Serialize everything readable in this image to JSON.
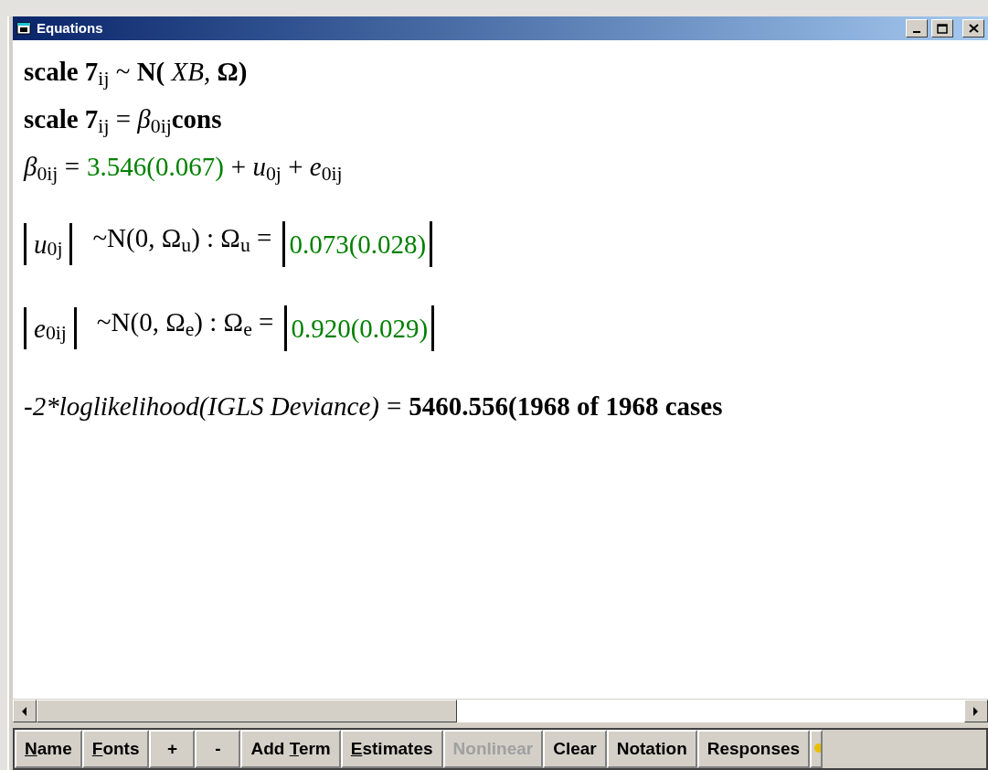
{
  "window": {
    "title": "Equations"
  },
  "equations": [
    {
      "kind": "line",
      "segments": [
        {
          "kind": "term",
          "text": "**scale 7**$_{ij}$ ~ **N(** *XB,*  **Ω)**"
        }
      ]
    },
    {
      "kind": "line",
      "segments": [
        {
          "kind": "term",
          "text": "**scale 7**$_{ij}$ = *β*$_{0ij}$**cons**"
        }
      ]
    },
    {
      "kind": "line",
      "segments": [
        {
          "kind": "term",
          "text": "*β*$_{0ij}$ ="
        },
        {
          "kind": "estimate",
          "text": "3.546(0.067)"
        },
        {
          "kind": "term",
          "text": "+ *u*$_{0j}$ + *e*$_{0ij}$"
        }
      ]
    },
    {
      "kind": "matrix",
      "vector": "*u*$_{0j}$",
      "distribution": "~N(0,  Ω$_{u}$)  :  Ω$_{u}$ =",
      "value": "0.073(0.028)"
    },
    {
      "kind": "matrix",
      "vector": "*e*$_{0ij}$",
      "distribution": "~N(0,  Ω$_{e}$)  :  Ω$_{e}$ =",
      "value": "0.920(0.029)"
    },
    {
      "kind": "line",
      "segments": [
        {
          "kind": "italic",
          "text": "-2*loglikelihood(IGLS Deviance)"
        },
        {
          "kind": "plain",
          "text": "="
        },
        {
          "kind": "bold",
          "text": "5460.556(1968 of 1968 cases"
        }
      ]
    }
  ],
  "toolbar": [
    {
      "parts": [
        {
          "text": "N",
          "underlined": true
        },
        {
          "text": "ame",
          "underlined": false
        }
      ],
      "disabled": false
    },
    {
      "parts": [
        {
          "text": "F",
          "underlined": true
        },
        {
          "text": "onts",
          "underlined": false
        }
      ],
      "disabled": false
    },
    {
      "parts": [
        {
          "text": "+",
          "underlined": false
        }
      ],
      "disabled": false
    },
    {
      "parts": [
        {
          "text": "-",
          "underlined": false
        }
      ],
      "disabled": false
    },
    {
      "parts": [
        {
          "text": "Add ",
          "underlined": false
        },
        {
          "text": "T",
          "underlined": true
        },
        {
          "text": "erm",
          "underlined": false
        }
      ],
      "disabled": false
    },
    {
      "parts": [
        {
          "text": "E",
          "underlined": true
        },
        {
          "text": "stimates",
          "underlined": false
        }
      ],
      "disabled": false
    },
    {
      "parts": [
        {
          "text": "Nonlinear",
          "underlined": false
        }
      ],
      "disabled": true
    },
    {
      "parts": [
        {
          "text": "Clear",
          "underlined": false
        }
      ],
      "disabled": false
    },
    {
      "parts": [
        {
          "text": "Notation",
          "underlined": false
        }
      ],
      "disabled": false
    },
    {
      "parts": [
        {
          "text": "Responses",
          "underlined": false
        }
      ],
      "disabled": false
    }
  ]
}
